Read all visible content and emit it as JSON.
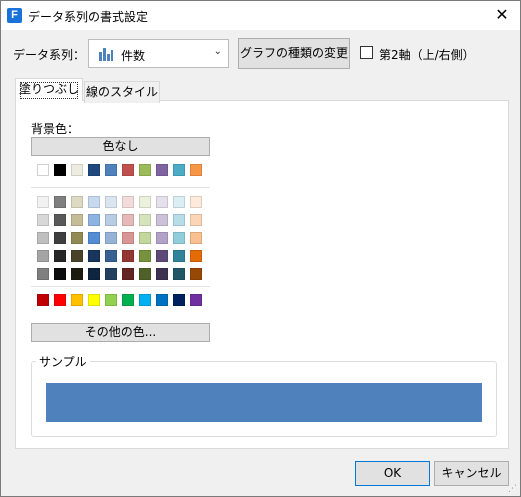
{
  "window": {
    "app_icon_letter": "F",
    "title": "データ系列の書式設定",
    "close_glyph": "✕"
  },
  "toolbar": {
    "series_label": "データ系列：",
    "series_value": "件数",
    "change_chart_type_label": "グラフの種類の変更",
    "secondary_axis_label": "第2軸（上/右側）",
    "secondary_axis_checked": false
  },
  "tabs": [
    {
      "label": "塗りつぶし",
      "active": true
    },
    {
      "label": "線のスタイル",
      "active": false
    }
  ],
  "fill": {
    "background_label": "背景色：",
    "no_color_label": "色なし",
    "other_colors_label": "その他の色...",
    "theme_row": [
      "#ffffff",
      "#000000",
      "#eeece1",
      "#1f497d",
      "#4f81bd",
      "#c0504d",
      "#9bbb59",
      "#8064a2",
      "#4bacc6",
      "#f79646"
    ],
    "shade_rows": [
      [
        "#f2f2f2",
        "#7f7f7f",
        "#ddd9c3",
        "#c6d9f0",
        "#dbe5f1",
        "#f2dcdb",
        "#ebf1dd",
        "#e5e0ec",
        "#dbeef3",
        "#fdeada"
      ],
      [
        "#d8d8d8",
        "#595959",
        "#c4bd97",
        "#8db3e2",
        "#b8cce4",
        "#e5b9b7",
        "#d7e3bc",
        "#ccc1d9",
        "#b7dde8",
        "#fbd5b5"
      ],
      [
        "#bfbfbf",
        "#3f3f3f",
        "#938953",
        "#548dd4",
        "#95b3d7",
        "#d99694",
        "#c3d69b",
        "#b2a2c7",
        "#92cddc",
        "#fac08f"
      ],
      [
        "#a5a5a5",
        "#262626",
        "#494429",
        "#17365d",
        "#366092",
        "#953734",
        "#76923c",
        "#5f497a",
        "#31859b",
        "#e36c09"
      ],
      [
        "#7f7f7f",
        "#0c0c0c",
        "#1d1b10",
        "#0f243e",
        "#244061",
        "#632423",
        "#4f6128",
        "#3f3151",
        "#205867",
        "#974806"
      ]
    ],
    "standard_row": [
      "#c00000",
      "#ff0000",
      "#ffc000",
      "#ffff00",
      "#92d050",
      "#00b050",
      "#00b0f0",
      "#0070c0",
      "#002060",
      "#7030a0"
    ]
  },
  "sample": {
    "label": "サンプル",
    "color": "#4f81bd"
  },
  "buttons": {
    "ok": "OK",
    "cancel": "キャンセル"
  }
}
